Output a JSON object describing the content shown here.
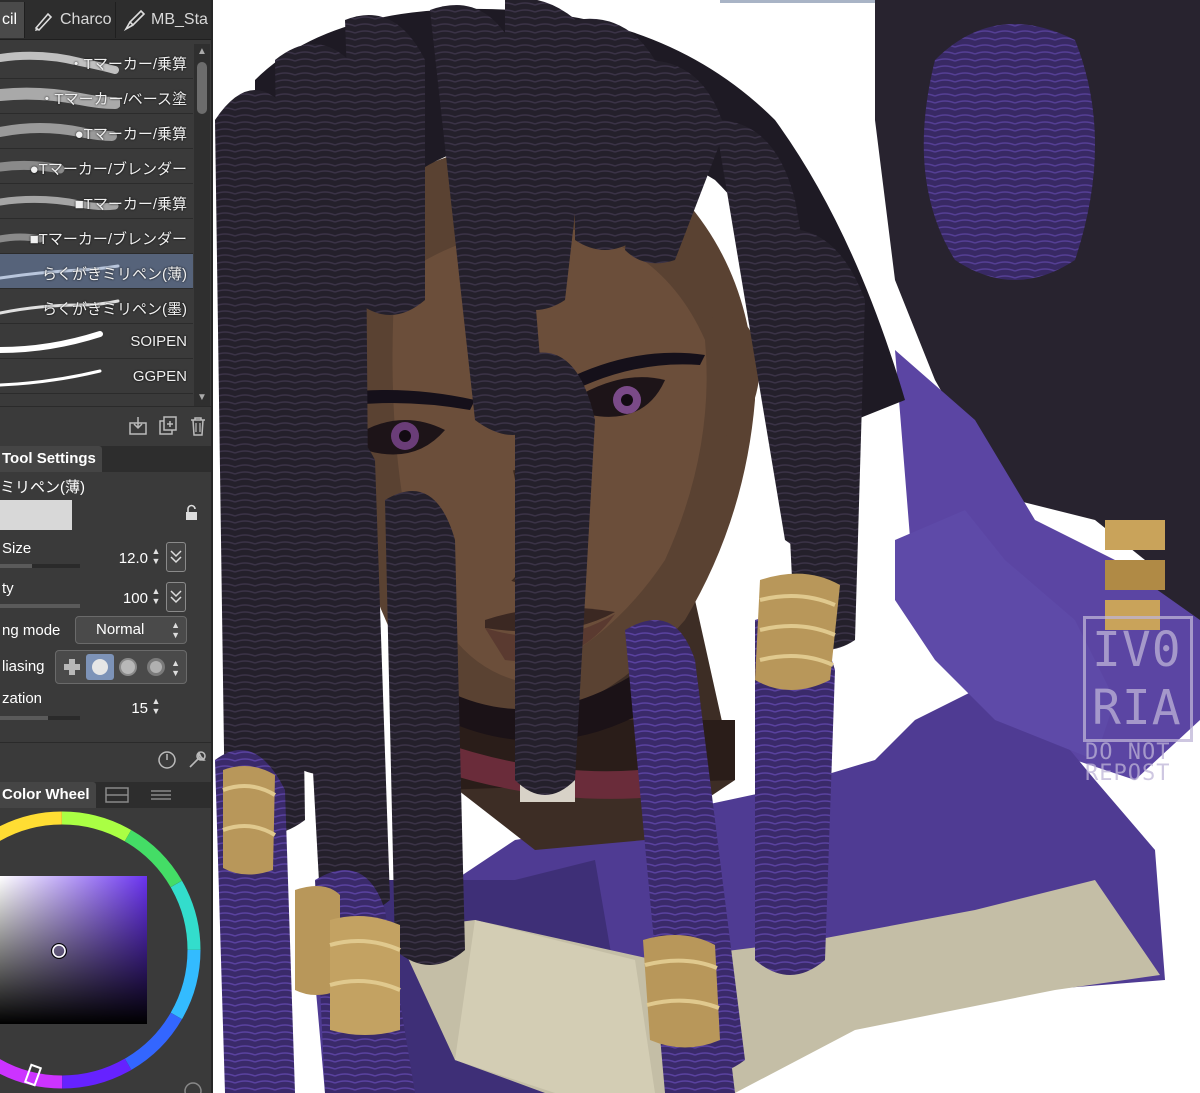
{
  "tabs": [
    {
      "label": "cil",
      "icon": "pencil-icon"
    },
    {
      "label": "Charco",
      "icon": "charcoal-icon"
    },
    {
      "label": "MB_Sta",
      "icon": "brush-icon"
    }
  ],
  "brushes": [
    {
      "label": "・Tマーカー/乗算"
    },
    {
      "label": "・Tマーカー/ベース塗"
    },
    {
      "label": "●Tマーカー/乗算"
    },
    {
      "label": "●Tマーカー/ブレンダー"
    },
    {
      "label": "■Tマーカー/乗算"
    },
    {
      "label": "■Tマーカー/ブレンダー"
    },
    {
      "label": "らくがきミリペン(薄)",
      "selected": true
    },
    {
      "label": "らくがきミリペン(墨)"
    },
    {
      "label": "SOIPEN"
    },
    {
      "label": "GGPEN"
    }
  ],
  "tool_settings": {
    "title": "Tool Settings",
    "tool_name": "ミリペン(薄)",
    "size_label": "Size",
    "size_value": "12.0",
    "opacity_label": "ty",
    "opacity_value": "100",
    "blending_label": "ng mode",
    "blending_value": "Normal",
    "antialiasing_label": "liasing",
    "stabilization_label": "zation",
    "stabilization_value": "15"
  },
  "color_panel": {
    "title": "Color Wheel",
    "current_color": "#6a33f0"
  },
  "artwork": {
    "watermark_line1": "IV0",
    "watermark_line2": "RIA",
    "watermark_line3": "DO NOT",
    "watermark_line4": "REPOST"
  }
}
